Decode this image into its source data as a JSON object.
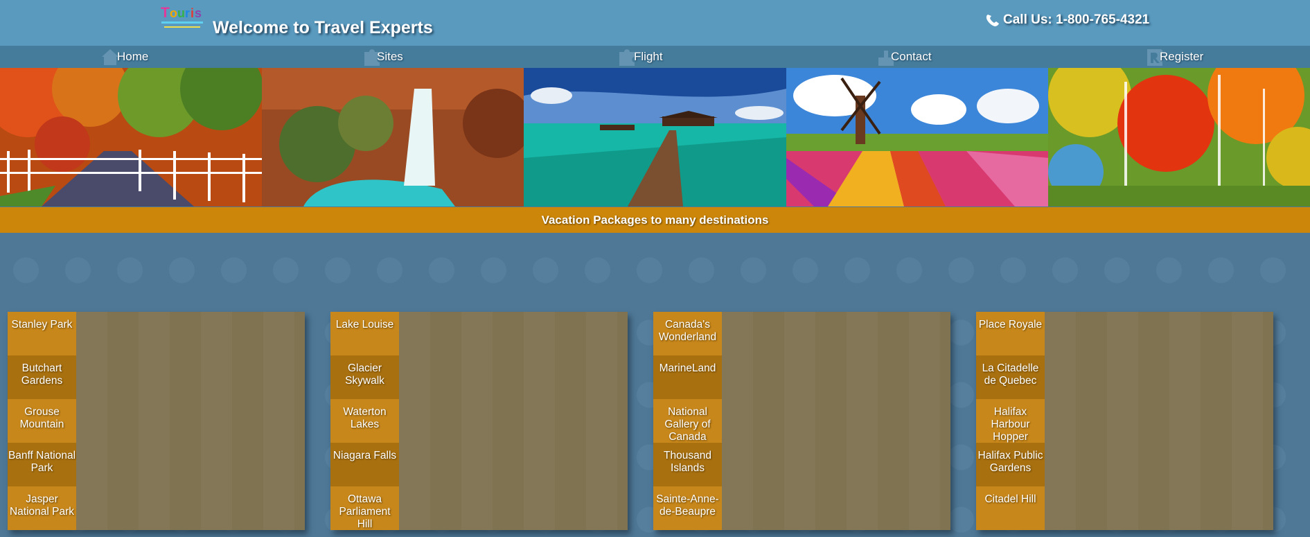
{
  "header": {
    "title": "Welcome to Travel Experts",
    "logo_text": "Tourists",
    "phone_label": "Call Us: 1-800-765-4321"
  },
  "nav": {
    "items": [
      {
        "label": "Home",
        "icon": "home-icon"
      },
      {
        "label": "Sites",
        "icon": "puzzle-icon"
      },
      {
        "label": "Flight",
        "icon": "puzzle-icon"
      },
      {
        "label": "Contact",
        "icon": "contact-icon"
      },
      {
        "label": "Register",
        "icon": "register-icon"
      }
    ]
  },
  "banner": {
    "photos": [
      "autumn-road",
      "waterfall",
      "boardwalk-pier",
      "windmill-tulips",
      "autumn-forest"
    ]
  },
  "ribbon": {
    "text": "Vacation Packages to many destinations"
  },
  "cards": [
    {
      "tabs": [
        "Stanley Park",
        "Butchart Gardens",
        "Grouse Mountain",
        "Banff National Park",
        "Jasper National Park"
      ]
    },
    {
      "tabs": [
        "Lake Louise",
        "Glacier Skywalk",
        "Waterton Lakes",
        "Niagara Falls",
        "Ottawa Parliament Hill"
      ]
    },
    {
      "tabs": [
        "Canada's Wonderland",
        "MarineLand",
        "National Gallery of Canada",
        "Thousand Islands",
        "Sainte-Anne-de-Beaupre"
      ]
    },
    {
      "tabs": [
        "Place Royale",
        "La Citadelle de Quebec",
        "Halifax Harbour Hopper",
        "Halifax Public Gardens",
        "Citadel Hill"
      ]
    }
  ],
  "colors": {
    "header": "#5a9abf",
    "nav": "#457c9c",
    "ribbon": "#cc8609",
    "card": "#7f7352",
    "tab_light": "#c7871b",
    "tab_dark": "#a8700f"
  }
}
